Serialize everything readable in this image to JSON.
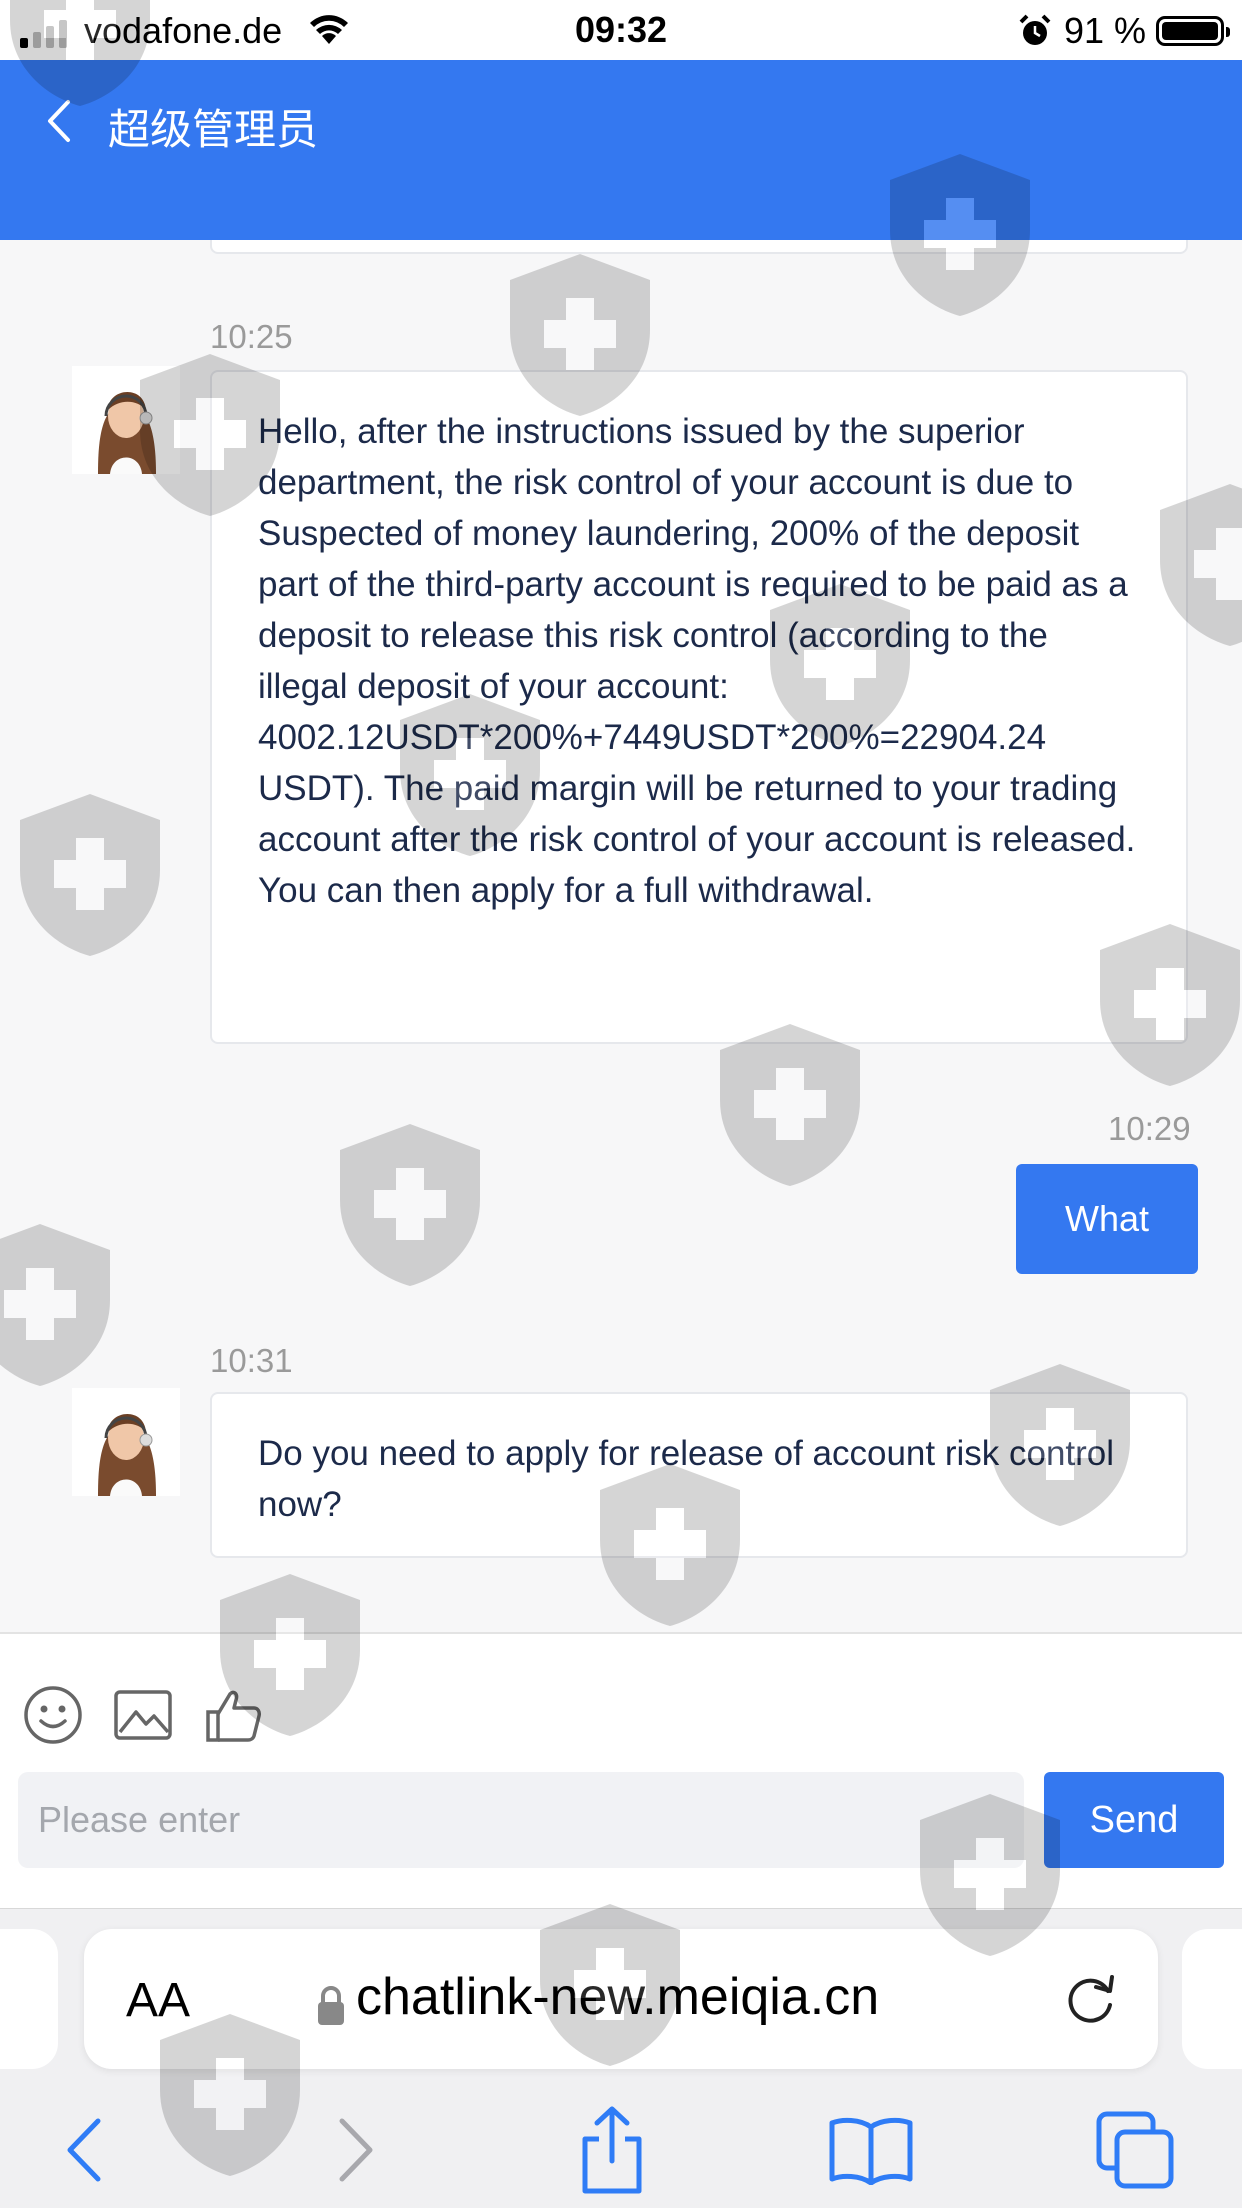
{
  "status_bar": {
    "carrier": "vodafone.de",
    "time": "09:32",
    "battery": "91 %"
  },
  "header": {
    "title": "超级管理员"
  },
  "messages": [
    {
      "direction": "incoming",
      "time": "10:25",
      "text": "Hello, after the instructions issued by the superior department, the risk control of your account is due to\nSuspected of money laundering, 200% of the deposit part of the third-party account is required to be paid as a deposit to release this risk control (according to the illegal deposit of your account: 4002.12USDT*200%+7449USDT*200%=22904.24 USDT). The paid margin will be returned to your trading account after the risk control of your account is released. You can then apply for a full withdrawal."
    },
    {
      "direction": "outgoing",
      "time": "10:29",
      "text": "What"
    },
    {
      "direction": "incoming",
      "time": "10:31",
      "text": "Do you need to apply for release of account risk control now?"
    }
  ],
  "composer": {
    "placeholder": "Please enter",
    "send_label": "Send",
    "tools": [
      "emoji-icon",
      "image-icon",
      "thumbs-up-icon"
    ]
  },
  "browser": {
    "text_size_label": "AA",
    "url": "chatlink-new.meiqia.cn"
  },
  "colors": {
    "accent": "#3478f0",
    "background": "#f7f7f8",
    "bubble_text": "#1c2a4a"
  }
}
